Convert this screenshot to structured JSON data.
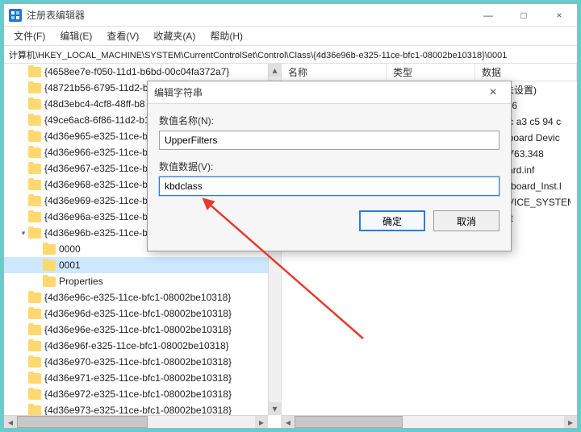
{
  "window": {
    "title": "注册表编辑器",
    "minimize": "—",
    "maximize": "□",
    "close": "×"
  },
  "menu": {
    "file": "文件(F)",
    "edit": "编辑(E)",
    "view": "查看(V)",
    "favorites": "收藏夹(A)",
    "help": "帮助(H)"
  },
  "address": "计算机\\HKEY_LOCAL_MACHINE\\SYSTEM\\CurrentControlSet\\Control\\Class\\{4d36e96b-e325-11ce-bfc1-08002be10318}\\0001",
  "tree": {
    "items": [
      {
        "label": "{4658ee7e-f050-11d1-b6bd-00c04fa372a7}",
        "indent": 0
      },
      {
        "label": "{48721b56-6795-11d2-b",
        "indent": 0
      },
      {
        "label": "{48d3ebc4-4cf8-48ff-b8",
        "indent": 0
      },
      {
        "label": "{49ce6ac8-6f86-11d2-b1",
        "indent": 0
      },
      {
        "label": "{4d36e965-e325-11ce-bf",
        "indent": 0
      },
      {
        "label": "{4d36e966-e325-11ce-bf",
        "indent": 0
      },
      {
        "label": "{4d36e967-e325-11ce-bf",
        "indent": 0
      },
      {
        "label": "{4d36e968-e325-11ce-bf",
        "indent": 0
      },
      {
        "label": "{4d36e969-e325-11ce-bf",
        "indent": 0
      },
      {
        "label": "{4d36e96a-e325-11ce-bf",
        "indent": 0
      },
      {
        "label": "{4d36e96b-e325-11ce-bf",
        "indent": 0,
        "expanded": true
      },
      {
        "label": "0000",
        "indent": 1
      },
      {
        "label": "0001",
        "indent": 1,
        "selected": true
      },
      {
        "label": "Properties",
        "indent": 1
      },
      {
        "label": "{4d36e96c-e325-11ce-bfc1-08002be10318}",
        "indent": 0
      },
      {
        "label": "{4d36e96d-e325-11ce-bfc1-08002be10318}",
        "indent": 0
      },
      {
        "label": "{4d36e96e-e325-11ce-bfc1-08002be10318}",
        "indent": 0
      },
      {
        "label": "{4d36e96f-e325-11ce-bfc1-08002be10318}",
        "indent": 0
      },
      {
        "label": "{4d36e970-e325-11ce-bfc1-08002be10318}",
        "indent": 0
      },
      {
        "label": "{4d36e971-e325-11ce-bfc1-08002be10318}",
        "indent": 0
      },
      {
        "label": "{4d36e972-e325-11ce-bfc1-08002be10318}",
        "indent": 0
      },
      {
        "label": "{4d36e973-e325-11ce-bfc1-08002be10318}",
        "indent": 0
      }
    ]
  },
  "list": {
    "columns": {
      "name": "名称",
      "type": "类型",
      "data": "数据"
    },
    "partial_rows": [
      {
        "data": "(数值未设置)"
      },
      {
        "data": "21-2006"
      },
      {
        "data": "0 80 8c a3 c5 94 c"
      },
      {
        "data": "D Keyboard Devic"
      },
      {
        "data": "0.0.17763.348"
      },
      {
        "data": "keyboard.inf"
      },
      {
        "data": "D_Keyboard_Inst.l"
      },
      {
        "data": "D_DEVICE_SYSTEM"
      },
      {
        "data": "icrosoft"
      }
    ]
  },
  "dialog": {
    "title": "编辑字符串",
    "name_label": "数值名称(N):",
    "name_value": "UpperFilters",
    "data_label": "数值数据(V):",
    "data_value": "kbdclass",
    "ok": "确定",
    "cancel": "取消",
    "close": "×"
  }
}
